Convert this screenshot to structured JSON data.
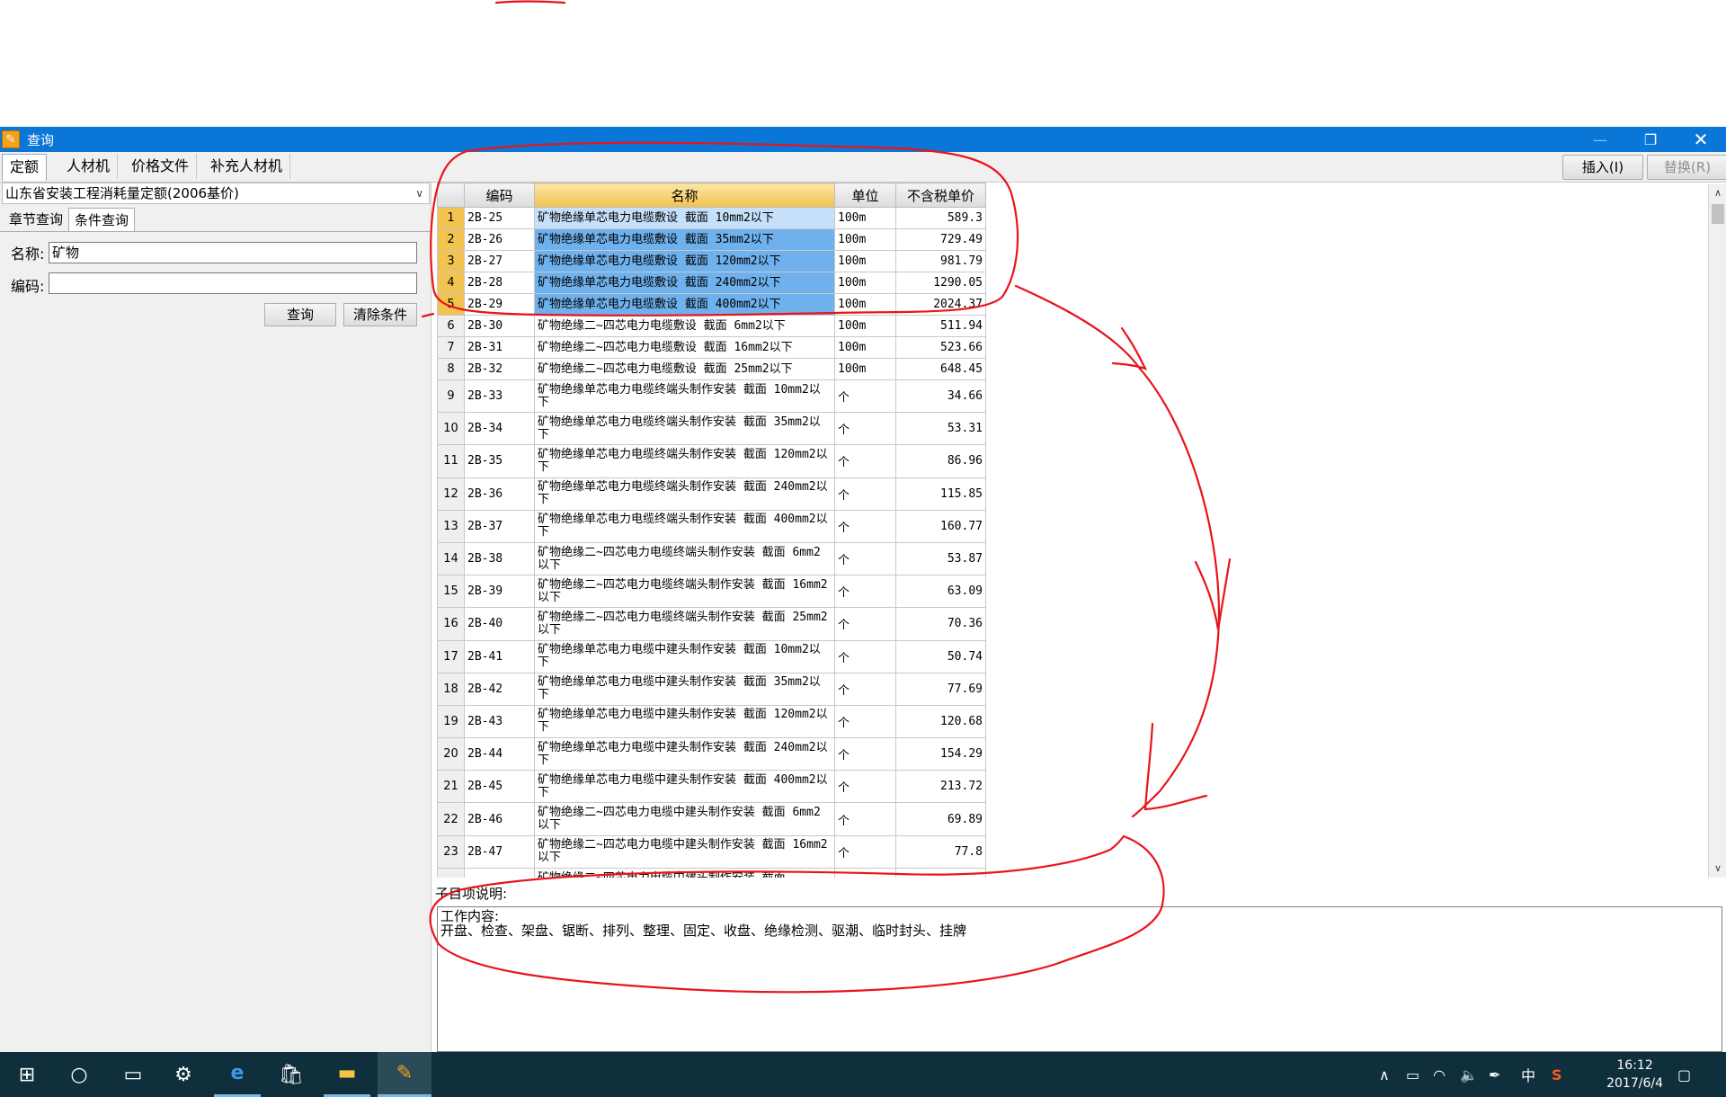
{
  "window": {
    "title": "查询",
    "app_icon": "quota-app-icon"
  },
  "top_tabs": [
    "定额",
    "人材机",
    "价格文件",
    "补充人材机"
  ],
  "toolbar": {
    "insert_label": "插入(I)",
    "replace_label": "替换(R)"
  },
  "left_panel": {
    "quota_book": "山东省安装工程消耗量定额(2006基价)",
    "sub_tabs": [
      "章节查询",
      "条件查询"
    ],
    "active_sub_tab": "条件查询",
    "name_label": "名称:",
    "name_value": "矿物",
    "code_label": "编码:",
    "code_value": "",
    "query_button": "查询",
    "clear_button": "清除条件"
  },
  "grid": {
    "columns": [
      "",
      "编码",
      "名称",
      "单位",
      "不含税单价"
    ],
    "selected_rows": [
      "1",
      "2",
      "3",
      "4",
      "5"
    ],
    "rows": [
      {
        "n": "1",
        "code": "2B-25",
        "name": "矿物绝缘单芯电力电缆敷设 截面 10mm2以下",
        "unit": "100m",
        "price": "589.3"
      },
      {
        "n": "2",
        "code": "2B-26",
        "name": "矿物绝缘单芯电力电缆敷设 截面 35mm2以下",
        "unit": "100m",
        "price": "729.49"
      },
      {
        "n": "3",
        "code": "2B-27",
        "name": "矿物绝缘单芯电力电缆敷设 截面 120mm2以下",
        "unit": "100m",
        "price": "981.79"
      },
      {
        "n": "4",
        "code": "2B-28",
        "name": "矿物绝缘单芯电力电缆敷设 截面 240mm2以下",
        "unit": "100m",
        "price": "1290.05"
      },
      {
        "n": "5",
        "code": "2B-29",
        "name": "矿物绝缘单芯电力电缆敷设 截面 400mm2以下",
        "unit": "100m",
        "price": "2024.37"
      },
      {
        "n": "6",
        "code": "2B-30",
        "name": "矿物绝缘二~四芯电力电缆敷设 截面 6mm2以下",
        "unit": "100m",
        "price": "511.94"
      },
      {
        "n": "7",
        "code": "2B-31",
        "name": "矿物绝缘二~四芯电力电缆敷设 截面 16mm2以下",
        "unit": "100m",
        "price": "523.66"
      },
      {
        "n": "8",
        "code": "2B-32",
        "name": "矿物绝缘二~四芯电力电缆敷设 截面 25mm2以下",
        "unit": "100m",
        "price": "648.45"
      },
      {
        "n": "9",
        "code": "2B-33",
        "name": "矿物绝缘单芯电力电缆终端头制作安装 截面 10mm2以下",
        "unit": "个",
        "price": "34.66"
      },
      {
        "n": "10",
        "code": "2B-34",
        "name": "矿物绝缘单芯电力电缆终端头制作安装 截面 35mm2以下",
        "unit": "个",
        "price": "53.31"
      },
      {
        "n": "11",
        "code": "2B-35",
        "name": "矿物绝缘单芯电力电缆终端头制作安装 截面 120mm2以下",
        "unit": "个",
        "price": "86.96"
      },
      {
        "n": "12",
        "code": "2B-36",
        "name": "矿物绝缘单芯电力电缆终端头制作安装 截面 240mm2以下",
        "unit": "个",
        "price": "115.85"
      },
      {
        "n": "13",
        "code": "2B-37",
        "name": "矿物绝缘单芯电力电缆终端头制作安装 截面 400mm2以下",
        "unit": "个",
        "price": "160.77"
      },
      {
        "n": "14",
        "code": "2B-38",
        "name": "矿物绝缘二~四芯电力电缆终端头制作安装 截面 6mm2以下",
        "unit": "个",
        "price": "53.87"
      },
      {
        "n": "15",
        "code": "2B-39",
        "name": "矿物绝缘二~四芯电力电缆终端头制作安装 截面 16mm2以下",
        "unit": "个",
        "price": "63.09"
      },
      {
        "n": "16",
        "code": "2B-40",
        "name": "矿物绝缘二~四芯电力电缆终端头制作安装 截面 25mm2以下",
        "unit": "个",
        "price": "70.36"
      },
      {
        "n": "17",
        "code": "2B-41",
        "name": "矿物绝缘单芯电力电缆中建头制作安装 截面 10mm2以下",
        "unit": "个",
        "price": "50.74"
      },
      {
        "n": "18",
        "code": "2B-42",
        "name": "矿物绝缘单芯电力电缆中建头制作安装 截面 35mm2以下",
        "unit": "个",
        "price": "77.69"
      },
      {
        "n": "19",
        "code": "2B-43",
        "name": "矿物绝缘单芯电力电缆中建头制作安装 截面 120mm2以下",
        "unit": "个",
        "price": "120.68"
      },
      {
        "n": "20",
        "code": "2B-44",
        "name": "矿物绝缘单芯电力电缆中建头制作安装 截面 240mm2以下",
        "unit": "个",
        "price": "154.29"
      },
      {
        "n": "21",
        "code": "2B-45",
        "name": "矿物绝缘单芯电力电缆中建头制作安装 截面 400mm2以下",
        "unit": "个",
        "price": "213.72"
      },
      {
        "n": "22",
        "code": "2B-46",
        "name": "矿物绝缘二~四芯电力电缆中建头制作安装 截面 6mm2以下",
        "unit": "个",
        "price": "69.89"
      },
      {
        "n": "23",
        "code": "2B-47",
        "name": "矿物绝缘二~四芯电力电缆中建头制作安装 截面 16mm2以下",
        "unit": "个",
        "price": "77.8"
      },
      {
        "n": "",
        "code": "",
        "name": "矿物绝缘二~四芯电力电缆中建头制作安装 截面",
        "unit": "",
        "price": ""
      }
    ]
  },
  "description": {
    "label": "子目项说明:",
    "line1": "工作内容:",
    "line2": "开盘、检查、架盘、锯断、排列、整理、固定、收盘、绝缘检测、驱潮、临时封头、挂牌"
  },
  "taskbar": {
    "icons": [
      "windows-start-icon",
      "cortana-search-icon",
      "task-view-icon",
      "settings-gear-icon",
      "edge-browser-icon",
      "store-icon",
      "file-explorer-icon",
      "quota-app-icon"
    ],
    "ime": "中",
    "time": "16:12",
    "date": "2017/6/4"
  },
  "colors": {
    "titlebar": "#0a77d8",
    "selected_row": "#6fb1ec",
    "row_header_selected": "#f3c350",
    "annotation": "#e8141b",
    "taskbar": "#0f2f3c"
  }
}
